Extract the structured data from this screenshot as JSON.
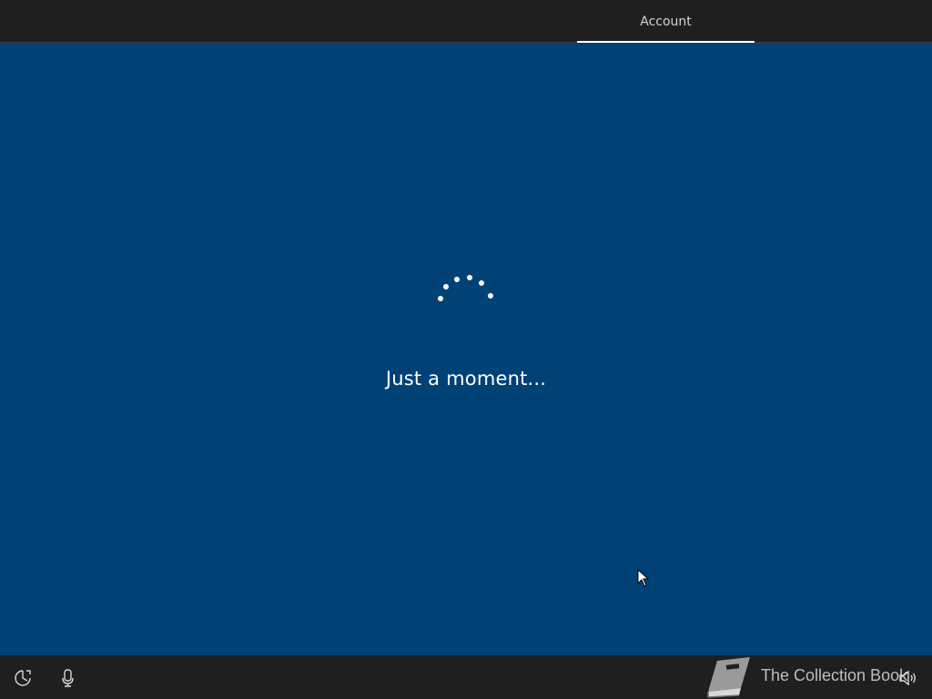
{
  "header": {
    "tabs": [
      {
        "label": "Account",
        "active": true
      }
    ]
  },
  "main": {
    "status_text": "Just a moment...",
    "background_color": "#004275"
  },
  "footer": {
    "buttons": [
      {
        "icon": "ease-of-access-icon"
      },
      {
        "icon": "microphone-icon"
      },
      {
        "icon": "volume-icon"
      }
    ],
    "watermark_text": "The Collection Book"
  },
  "colors": {
    "bar": "#1f1f1f",
    "accent": "#004275",
    "text": "#ffffff"
  }
}
